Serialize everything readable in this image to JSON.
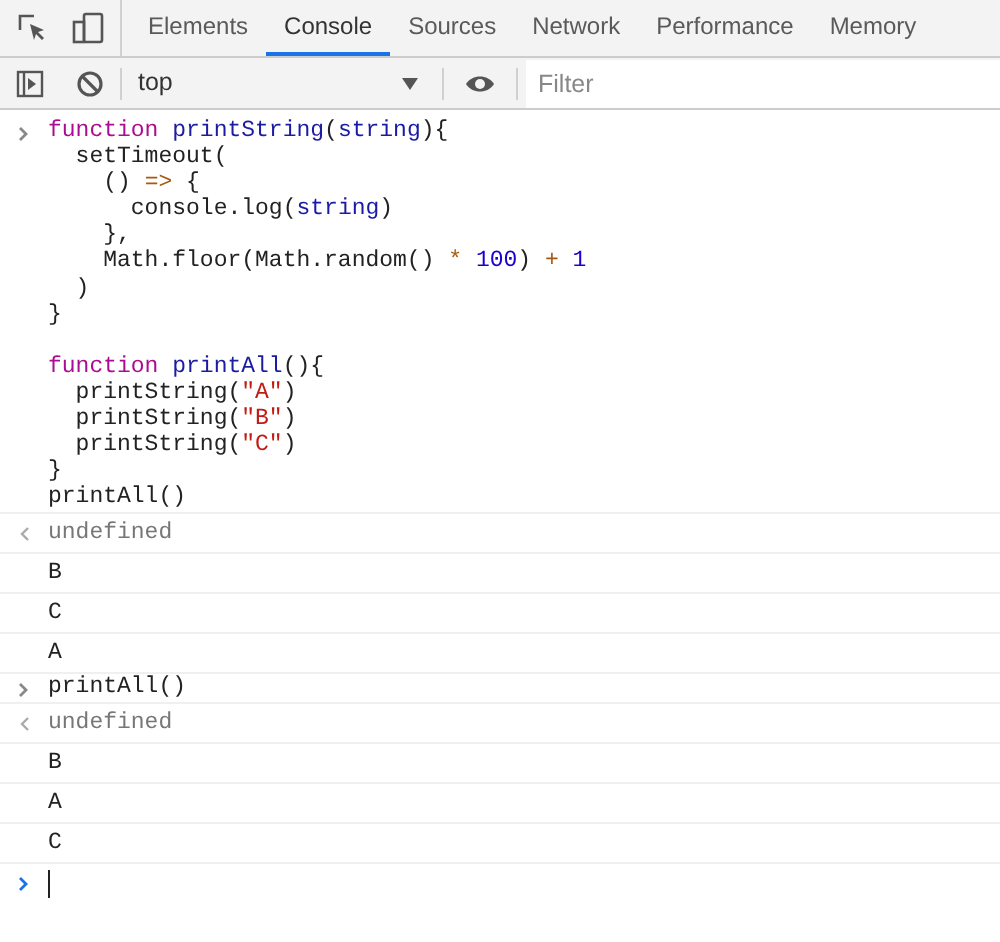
{
  "tabs": [
    {
      "label": "Elements",
      "selected": false
    },
    {
      "label": "Console",
      "selected": true
    },
    {
      "label": "Sources",
      "selected": false
    },
    {
      "label": "Network",
      "selected": false
    },
    {
      "label": "Performance",
      "selected": false
    },
    {
      "label": "Memory",
      "selected": false
    }
  ],
  "toolbar": {
    "context": "top",
    "filter": {
      "placeholder": "Filter"
    }
  },
  "entries": [
    {
      "kind": "input",
      "blocks": [
        [
          [
            {
              "t": "function ",
              "kind": "keyword"
            },
            {
              "t": "printString",
              "kind": "name"
            },
            {
              "t": "(",
              "kind": "plain"
            },
            {
              "t": "string",
              "kind": "param"
            },
            {
              "t": "){",
              "kind": "plain"
            }
          ],
          [
            {
              "t": "  setTimeout(",
              "kind": "plain"
            }
          ],
          [
            {
              "t": "    () ",
              "kind": "plain"
            },
            {
              "t": "=>",
              "kind": "op"
            },
            {
              "t": " {",
              "kind": "plain"
            }
          ],
          [
            {
              "t": "      console.log(",
              "kind": "plain"
            },
            {
              "t": "string",
              "kind": "param"
            },
            {
              "t": ")",
              "kind": "plain"
            }
          ],
          [
            {
              "t": "    },",
              "kind": "plain"
            }
          ],
          [
            {
              "t": "    Math.floor(Math.random() ",
              "kind": "plain"
            },
            {
              "t": "* ",
              "kind": "op"
            },
            {
              "t": "100",
              "kind": "number"
            },
            {
              "t": ") ",
              "kind": "plain"
            },
            {
              "t": "+ ",
              "kind": "op"
            },
            {
              "t": "1",
              "kind": "number"
            }
          ],
          [
            {
              "t": "  )",
              "kind": "plain"
            }
          ],
          [
            {
              "t": "}",
              "kind": "plain"
            }
          ]
        ],
        [
          [
            {
              "t": "function ",
              "kind": "keyword"
            },
            {
              "t": "printAll",
              "kind": "name"
            },
            {
              "t": "(){",
              "kind": "plain"
            }
          ],
          [
            {
              "t": "  printString(",
              "kind": "plain"
            },
            {
              "t": "\"A\"",
              "kind": "string"
            },
            {
              "t": ")",
              "kind": "plain"
            }
          ],
          [
            {
              "t": "  printString(",
              "kind": "plain"
            },
            {
              "t": "\"B\"",
              "kind": "string"
            },
            {
              "t": ")",
              "kind": "plain"
            }
          ],
          [
            {
              "t": "  printString(",
              "kind": "plain"
            },
            {
              "t": "\"C\"",
              "kind": "string"
            },
            {
              "t": ")",
              "kind": "plain"
            }
          ],
          [
            {
              "t": "}",
              "kind": "plain"
            }
          ],
          [
            {
              "t": "printAll()",
              "kind": "plain"
            }
          ]
        ]
      ]
    },
    {
      "kind": "result",
      "text": "undefined"
    },
    {
      "kind": "log",
      "text": "B"
    },
    {
      "kind": "log",
      "text": "C"
    },
    {
      "kind": "log",
      "text": "A"
    },
    {
      "kind": "input",
      "blocks": [
        [
          [
            {
              "t": "printAll()",
              "kind": "plain"
            }
          ]
        ]
      ]
    },
    {
      "kind": "result",
      "text": "undefined"
    },
    {
      "kind": "log",
      "text": "B"
    },
    {
      "kind": "log",
      "text": "A"
    },
    {
      "kind": "log",
      "text": "C"
    }
  ]
}
